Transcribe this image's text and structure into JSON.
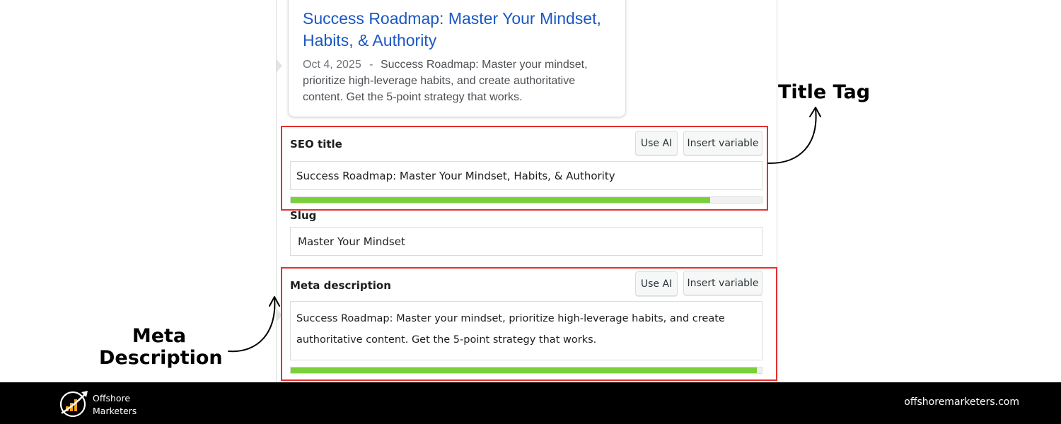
{
  "serp_preview": {
    "title": "Success Roadmap: Master Your Mindset, Habits, & Authority",
    "date": "Oct 4, 2025",
    "separator": "-",
    "description": "Success Roadmap: Master your mindset, prioritize high-leverage habits, and create authoritative content. Get the 5-point strategy that works."
  },
  "seo_title": {
    "label": "SEO title",
    "use_ai_label": "Use AI",
    "insert_variable_label": "Insert variable",
    "value": "Success Roadmap: Master Your Mindset, Habits, & Authority",
    "progress": 0.89,
    "progress_color": "#7ad03a"
  },
  "slug": {
    "label": "Slug",
    "value": "Master Your Mindset"
  },
  "meta_description": {
    "label": "Meta description",
    "use_ai_label": "Use AI",
    "insert_variable_label": "Insert variable",
    "value": "Success Roadmap: Master your mindset, prioritize high-leverage habits, and create authoritative content. Get the 5-point strategy that works.",
    "progress": 0.99,
    "progress_color": "#7ad03a"
  },
  "annotations": {
    "title_tag": "Title Tag",
    "meta_description_line1": "Meta",
    "meta_description_line2": "Description",
    "highlight_color": "#e5302b"
  },
  "footer": {
    "brand_line1": "Offshore",
    "brand_line2": "Marketers",
    "website": "offshoremarketers.com",
    "background": "#000000",
    "logo_accent": "#f5a01a"
  }
}
